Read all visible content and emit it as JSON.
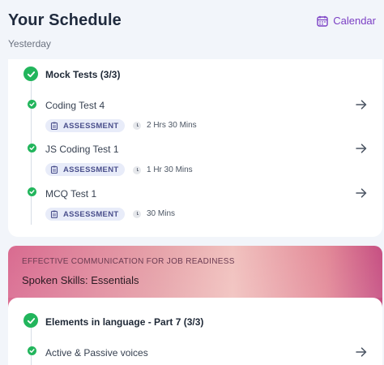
{
  "header": {
    "title": "Your Schedule",
    "calendar_label": "Calendar",
    "date_label": "Yesterday"
  },
  "colors": {
    "accent": "#7b3fc4",
    "success": "#22b55c",
    "badge_bg": "#e8ecf9",
    "badge_text": "#4a4f8c"
  },
  "schedule": {
    "section_title": "Mock Tests (3/3)",
    "items": [
      {
        "title": "Coding Test 4",
        "badge": "ASSESSMENT",
        "duration": "2 Hrs 30 Mins",
        "completed": true
      },
      {
        "title": "JS Coding Test 1",
        "badge": "ASSESSMENT",
        "duration": "1 Hr 30 Mins",
        "completed": true
      },
      {
        "title": "MCQ Test 1",
        "badge": "ASSESSMENT",
        "duration": "30 Mins",
        "completed": true
      }
    ]
  },
  "course": {
    "category": "EFFECTIVE COMMUNICATION FOR JOB READINESS",
    "name": "Spoken Skills: Essentials",
    "section_title": "Elements in language - Part 7 (3/3)",
    "items": [
      {
        "title": "Active & Passive voices",
        "completed": true
      }
    ]
  },
  "icons": {
    "calendar": "calendar-icon",
    "check": "check-circle-icon",
    "arrow": "arrow-right-icon",
    "assessment": "clipboard-icon",
    "duration": "clock-icon"
  }
}
